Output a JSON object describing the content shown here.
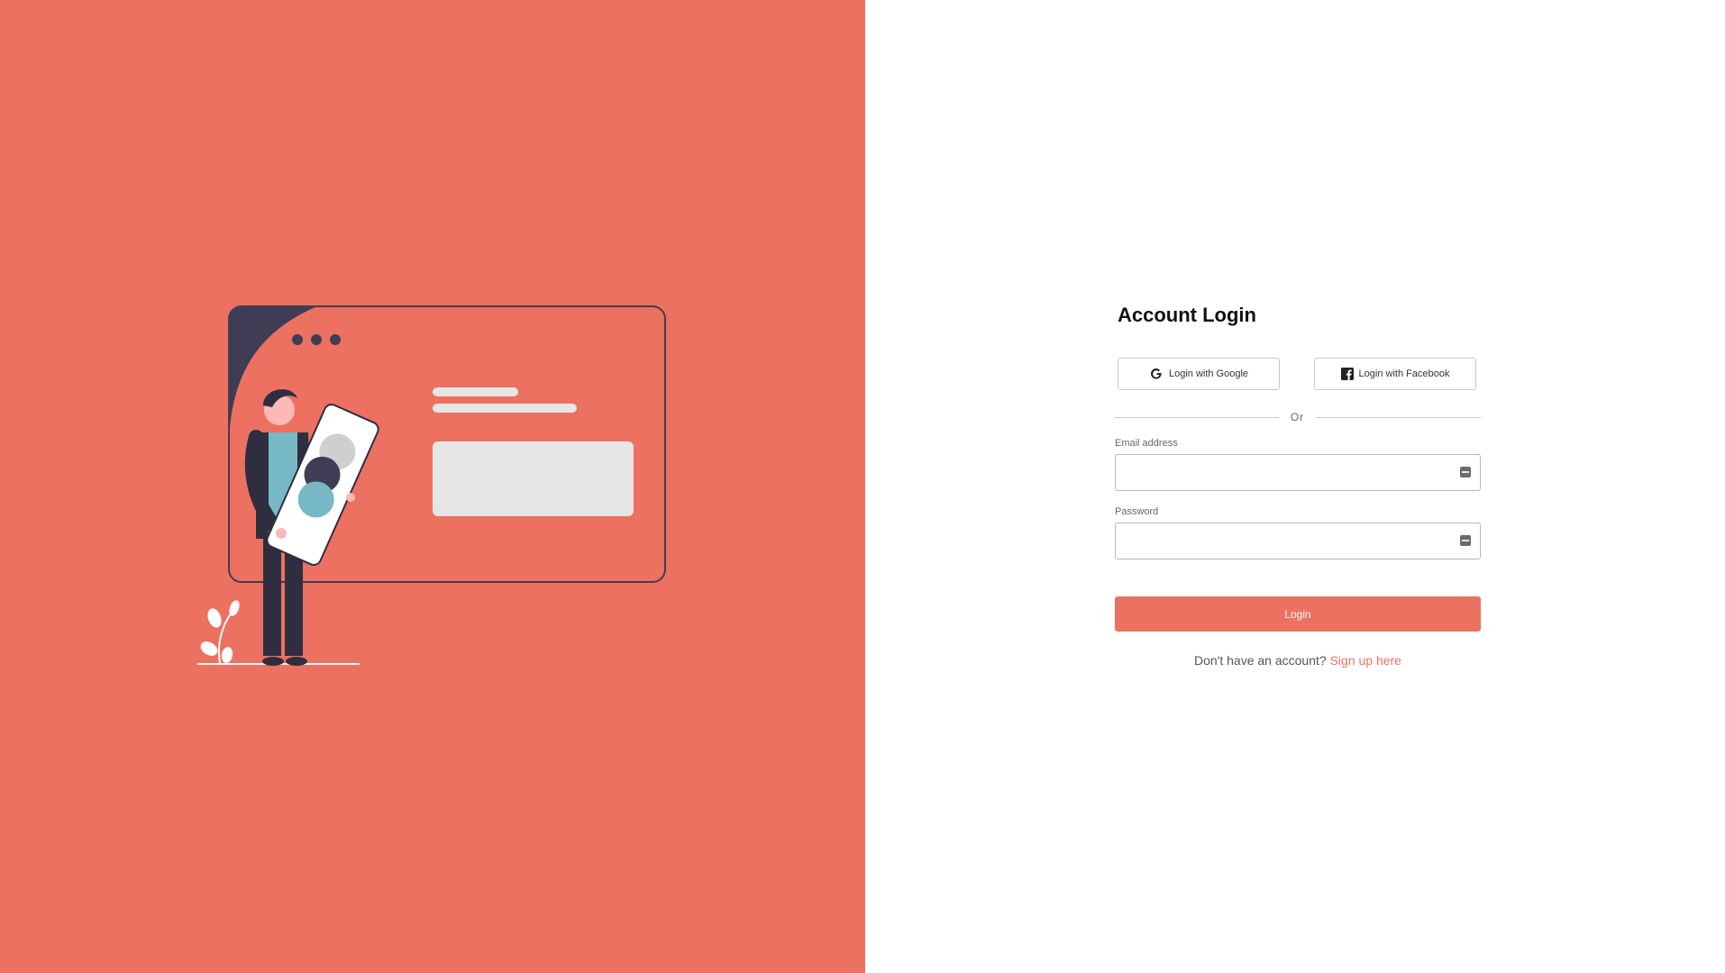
{
  "colors": {
    "accent": "#EC7160",
    "text_dark": "#111111",
    "border": "#c9c9c9"
  },
  "login_form": {
    "title": "Account Login",
    "google_button": "Login with Google",
    "facebook_button": "Login with Facebook",
    "divider_text": "Or",
    "email": {
      "label": "Email address",
      "value": "",
      "placeholder": "",
      "icon": "autofill-icon"
    },
    "password": {
      "label": "Password",
      "value": "",
      "placeholder": "",
      "icon": "autofill-icon"
    },
    "submit_label": "Login",
    "signup_prompt": "Don't have an account?",
    "signup_link": "Sign up here"
  },
  "illustration": {
    "icon": "person-holding-phone-illustration"
  }
}
